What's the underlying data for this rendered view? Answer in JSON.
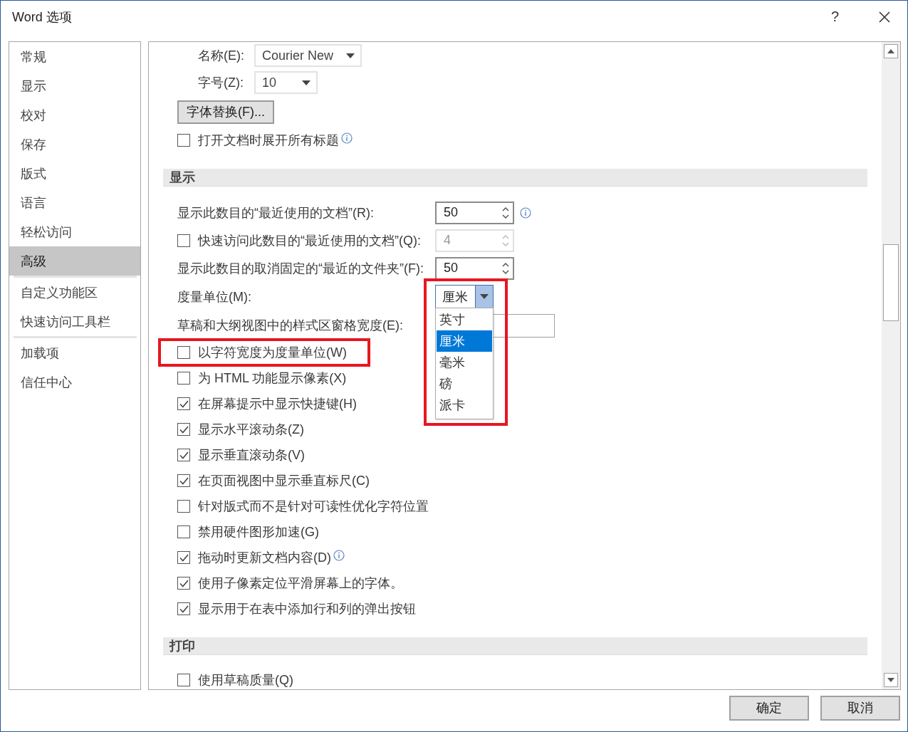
{
  "window": {
    "title": "Word 选项",
    "help": "?"
  },
  "sidebar": {
    "groups": [
      {
        "items": [
          {
            "label": "常规",
            "selected": false
          },
          {
            "label": "显示",
            "selected": false
          },
          {
            "label": "校对",
            "selected": false
          },
          {
            "label": "保存",
            "selected": false
          },
          {
            "label": "版式",
            "selected": false
          },
          {
            "label": "语言",
            "selected": false
          },
          {
            "label": "轻松访问",
            "selected": false
          },
          {
            "label": "高级",
            "selected": true
          }
        ]
      },
      {
        "items": [
          {
            "label": "自定义功能区",
            "selected": false
          },
          {
            "label": "快速访问工具栏",
            "selected": false
          }
        ]
      },
      {
        "items": [
          {
            "label": "加载项",
            "selected": false
          },
          {
            "label": "信任中心",
            "selected": false
          }
        ]
      }
    ]
  },
  "sections": [
    {
      "rows": [
        {
          "kind": "dropdown",
          "label": "名称(E):",
          "value": "Courier New"
        },
        {
          "kind": "dropdown",
          "label": "字号(Z):",
          "value": "10"
        },
        {
          "kind": "button",
          "label": "字体替换(F)..."
        },
        {
          "kind": "checkbox",
          "label": "打开文档时展开所有标题",
          "checked": false,
          "info": true
        }
      ]
    },
    {
      "heading": "显示",
      "rows": [
        {
          "kind": "spinner",
          "label": "显示此数目的“最近使用的文档”(R):",
          "value": "50",
          "info": true
        },
        {
          "kind": "checkbox_spinner",
          "label": "快速访问此数目的“最近使用的文档”(Q):",
          "checked": false,
          "value": "4",
          "disabled": true
        },
        {
          "kind": "spinner",
          "label": "显示此数目的取消固定的“最近的文件夹”(F):",
          "value": "50"
        },
        {
          "kind": "open_dropdown",
          "label": "度量单位(M):",
          "value": "厘米",
          "highlighted": true,
          "options": [
            {
              "label": "英寸",
              "selected": false
            },
            {
              "label": "厘米",
              "selected": true
            },
            {
              "label": "毫米",
              "selected": false
            },
            {
              "label": "磅",
              "selected": false
            },
            {
              "label": "派卡",
              "selected": false
            }
          ]
        },
        {
          "kind": "text_field",
          "label": "草稿和大纲视图中的样式区窗格宽度(E):"
        },
        {
          "kind": "checkbox",
          "label": "以字符宽度为度量单位(W)",
          "checked": false,
          "highlighted": true
        },
        {
          "kind": "checkbox",
          "label": "为 HTML 功能显示像素(X)",
          "checked": false
        },
        {
          "kind": "checkbox",
          "label": "在屏幕提示中显示快捷键(H)",
          "checked": true
        },
        {
          "kind": "checkbox",
          "label": "显示水平滚动条(Z)",
          "checked": true
        },
        {
          "kind": "checkbox",
          "label": "显示垂直滚动条(V)",
          "checked": true
        },
        {
          "kind": "checkbox",
          "label": "在页面视图中显示垂直标尺(C)",
          "checked": true
        },
        {
          "kind": "checkbox",
          "label": "针对版式而不是针对可读性优化字符位置",
          "checked": false
        },
        {
          "kind": "checkbox",
          "label": "禁用硬件图形加速(G)",
          "checked": false
        },
        {
          "kind": "checkbox",
          "label": "拖动时更新文档内容(D)",
          "checked": true,
          "info": true
        },
        {
          "kind": "checkbox",
          "label": "使用子像素定位平滑屏幕上的字体。",
          "checked": true
        },
        {
          "kind": "checkbox",
          "label": "显示用于在表中添加行和列的弹出按钮",
          "checked": true
        }
      ]
    },
    {
      "heading": "打印",
      "rows": [
        {
          "kind": "checkbox",
          "label": "使用草稿质量(Q)",
          "checked": false
        }
      ]
    }
  ],
  "footer": {
    "buttons": [
      "确定",
      "取消"
    ]
  }
}
